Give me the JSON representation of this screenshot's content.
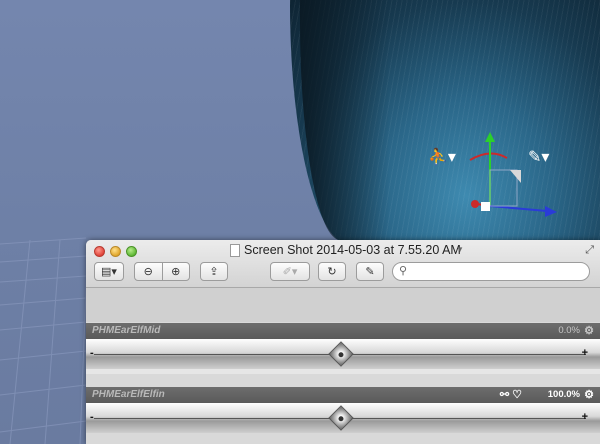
{
  "window": {
    "title": "Screen Shot 2014-05-03 at 7.55.20 AM",
    "title_menu_icon": "chevron-down-icon"
  },
  "toolbar": {
    "sidebar_icon": "sidebar-icon",
    "zoom_out_icon": "zoom-out-icon",
    "zoom_in_icon": "zoom-in-icon",
    "share_icon": "share-icon",
    "highlight_icon": "highlighter-icon",
    "rotate_icon": "rotate-icon",
    "annotate_icon": "edit-icon",
    "search_placeholder": ""
  },
  "morphs": [
    {
      "name": "PHMEarElfMid",
      "value_text": "0.0%",
      "value": 0.0,
      "active": false
    },
    {
      "name": "PHMEarElfElfin",
      "value_text": "100.0%",
      "value": 1.0,
      "active": true
    }
  ],
  "viewport": {
    "icons": [
      "figure-pose-icon",
      "pin-icon",
      "transform-gizmo-icon"
    ]
  },
  "colors": {
    "close": "#e0443a",
    "minimize": "#e0a52a",
    "maximize": "#5fb835",
    "hair": "#2a6688",
    "viewport_bg": "#7486ae"
  }
}
